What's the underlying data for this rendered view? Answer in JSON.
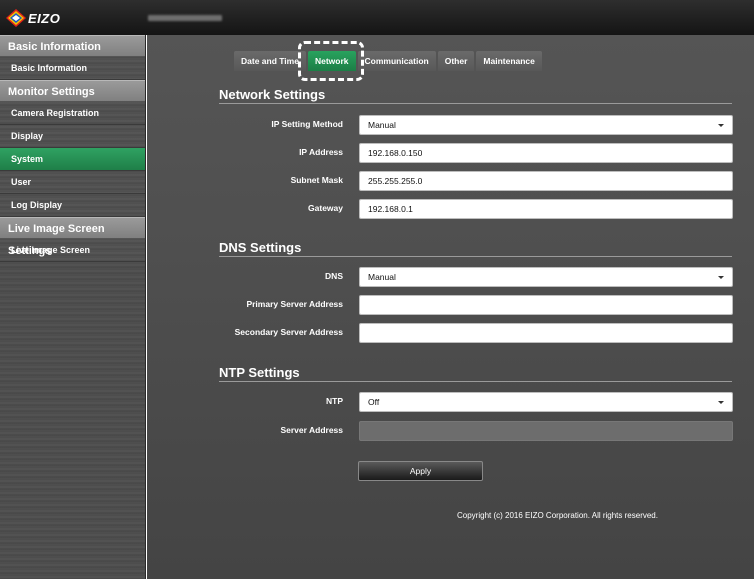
{
  "brand": {
    "name": "EIZO"
  },
  "sidebar": {
    "sections": [
      {
        "title": "Basic Information",
        "items": [
          {
            "label": "Basic Information"
          }
        ]
      },
      {
        "title": "Monitor Settings",
        "items": [
          {
            "label": "Camera Registration"
          },
          {
            "label": "Display"
          },
          {
            "label": "System",
            "active": true
          },
          {
            "label": "User"
          },
          {
            "label": "Log Display"
          }
        ]
      },
      {
        "title": "Live Image Screen Settings",
        "items": [
          {
            "label": "Live Image Screen"
          }
        ]
      }
    ]
  },
  "tabs": [
    {
      "label": "Date and Time"
    },
    {
      "label": "Network",
      "active": true
    },
    {
      "label": "Communication"
    },
    {
      "label": "Other"
    },
    {
      "label": "Maintenance"
    }
  ],
  "network": {
    "title": "Network Settings",
    "ip_method_label": "IP Setting Method",
    "ip_method_value": "Manual",
    "ip_label": "IP Address",
    "ip_value": "192.168.0.150",
    "subnet_label": "Subnet Mask",
    "subnet_value": "255.255.255.0",
    "gateway_label": "Gateway",
    "gateway_value": "192.168.0.1"
  },
  "dns": {
    "title": "DNS Settings",
    "dns_label": "DNS",
    "dns_value": "Manual",
    "primary_label": "Primary Server Address",
    "primary_value": "",
    "secondary_label": "Secondary Server Address",
    "secondary_value": ""
  },
  "ntp": {
    "title": "NTP Settings",
    "ntp_label": "NTP",
    "ntp_value": "Off",
    "server_label": "Server Address",
    "server_value": ""
  },
  "apply_label": "Apply",
  "copyright": "Copyright (c) 2016 EIZO Corporation. All rights reserved.",
  "colors": {
    "accent": "#23925a",
    "highlight": "#ffffff"
  }
}
